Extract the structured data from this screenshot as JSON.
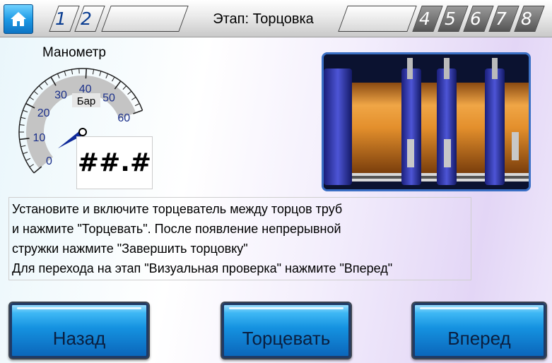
{
  "topbar": {
    "stage_title": "Этап: Торцовка",
    "steps_left": [
      "1",
      "2"
    ],
    "steps_right": [
      "4",
      "5",
      "6",
      "7",
      "8"
    ]
  },
  "gauge": {
    "label": "Манометр",
    "unit": "Бар",
    "ticks": [
      "0",
      "10",
      "20",
      "30",
      "40",
      "50",
      "60"
    ],
    "value_display": "##.#",
    "range": [
      0,
      60
    ],
    "needle_value": 2
  },
  "instructions": {
    "lines": [
      "Установите и включите торцеватель между торцов труб",
      "и нажмите \"Торцевать\". После появление непрерывной",
      "стружки нажмите \"Завершить торцовку\"",
      "Для перехода на этап \"Визуальная проверка\" нажмите \"Вперед\""
    ]
  },
  "buttons": {
    "back": "Назад",
    "face": "Торцевать",
    "forward": "Вперед"
  },
  "colors": {
    "accent": "#1592e0",
    "step_text": "#0a3d91",
    "pipe": "#d9892c"
  },
  "icons": {
    "home": "home-icon"
  }
}
